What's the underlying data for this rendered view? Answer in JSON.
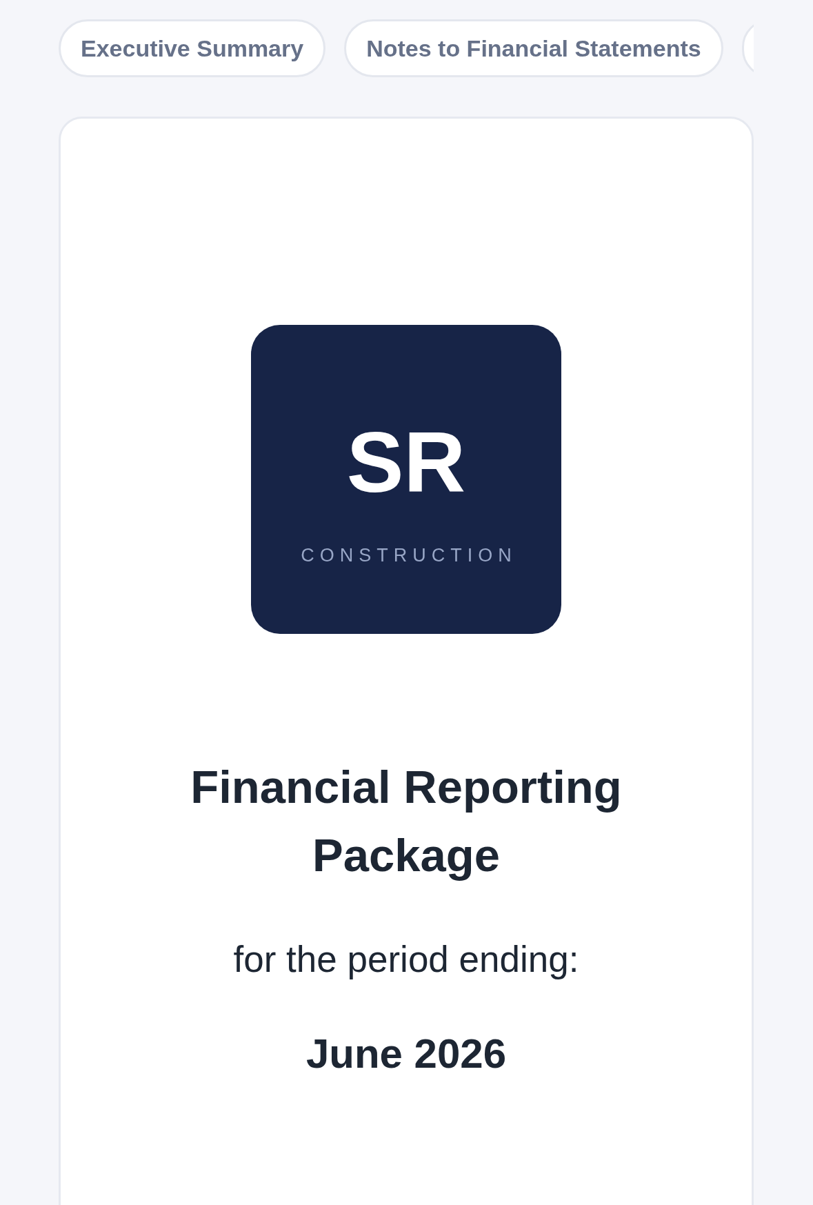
{
  "tabs": [
    {
      "label": "Executive Summary",
      "selected": false
    },
    {
      "label": "Notes to Financial Statements",
      "selected": false
    },
    {
      "selected": false
    }
  ],
  "cover": {
    "logo": {
      "monogram": "SR",
      "subtitle": "CONSTRUCTION"
    },
    "title": "Financial Reporting Package",
    "period_label": "for the period ending:",
    "period": "June 2026"
  }
}
